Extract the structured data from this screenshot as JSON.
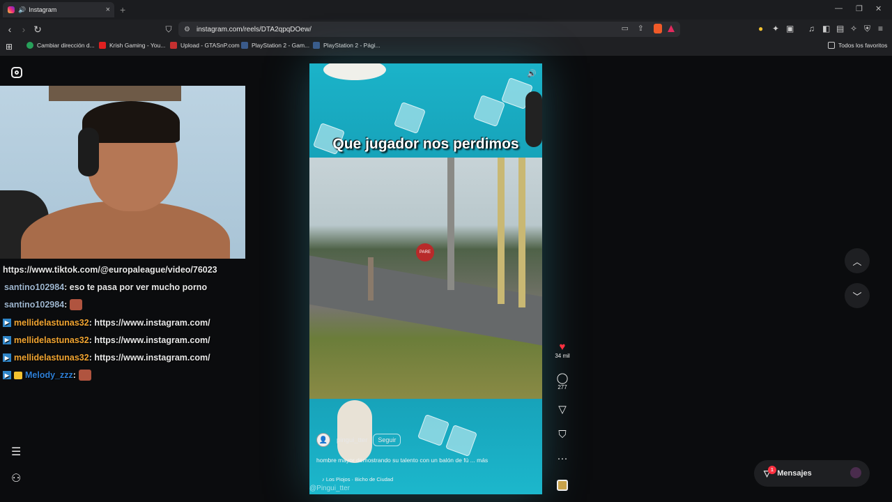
{
  "browser": {
    "tab_title": "Instagram",
    "tab_close": "×",
    "new_tab": "+",
    "url": "instagram.com/reels/DTA2qpqDOew/",
    "bookmarks": [
      {
        "label": "Cambiar dirección d...",
        "color": "#27a05a"
      },
      {
        "label": "Krish Gaming - You...",
        "color": "#e02020"
      },
      {
        "label": "Upload - GTASnP.com",
        "color": "#c43030"
      },
      {
        "label": "PlayStation 2 - Gam...",
        "color": "#3a5a8a"
      },
      {
        "label": "PlayStation 2 - Pági...",
        "color": "#3a5a8a"
      }
    ],
    "favorites_label": "Todos los favoritos"
  },
  "chat": {
    "lines": [
      {
        "user": "",
        "text": "https://www.tiktok.com/@europaleague/video/76023",
        "user_color": "#ffffff"
      },
      {
        "user": "santino102984",
        "text": " : eso te pasa por ver mucho porno",
        "user_color": "#9fb7d0"
      },
      {
        "user": "santino102984",
        "text": " : ",
        "user_color": "#9fb7d0"
      },
      {
        "user": "mellidelastunas32",
        "text": " : https://www.instagram.com/",
        "user_color": "#f2a531"
      },
      {
        "user": "mellidelastunas32",
        "text": " : https://www.instagram.com/",
        "user_color": "#f2a531"
      },
      {
        "user": "mellidelastunas32",
        "text": " : https://www.instagram.com/",
        "user_color": "#f2a531"
      },
      {
        "user": "Melody_zzz",
        "text": " : ",
        "user_color": "#2e7fd6"
      }
    ]
  },
  "reel": {
    "caption_overlay": "Que jugador nos perdimos",
    "stop_sign": "PARE",
    "username": "pingui_tter",
    "follow_label": "Seguir",
    "description": "hombre mayor demostrando su talento con un balón de fú ... más",
    "song": "Los Piojos · Bicho de Ciudad",
    "watermark": "@Pingui_tter",
    "likes": "34 mil",
    "comments": "277",
    "more": "···"
  },
  "messages": {
    "label": "Mensajes",
    "notif_count": "1"
  },
  "colors": {
    "reel_bg": "#1aa0b8",
    "like": "#ff3040"
  }
}
